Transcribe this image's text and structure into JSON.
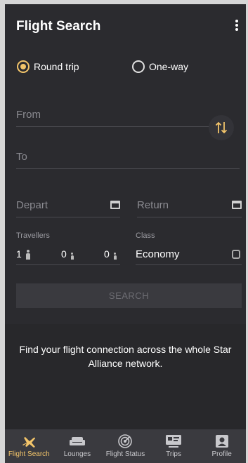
{
  "header": {
    "title": "Flight Search",
    "menu_icon": "more-vertical-icon"
  },
  "trip_type": {
    "options": [
      {
        "label": "Round trip",
        "selected": true
      },
      {
        "label": "One-way",
        "selected": false
      }
    ]
  },
  "form": {
    "from_placeholder": "From",
    "to_placeholder": "To",
    "swap_icon": "swap-vertical-icon",
    "depart_placeholder": "Depart",
    "return_placeholder": "Return",
    "travellers_label": "Travellers",
    "travellers": {
      "adults": "1",
      "children": "0",
      "infants": "0"
    },
    "class_label": "Class",
    "class_value": "Economy"
  },
  "search_button": "SEARCH",
  "info_text": "Find your flight connection across the whole Star Alliance network.",
  "nav": [
    {
      "label": "Flight Search",
      "icon": "plane-icon",
      "active": true
    },
    {
      "label": "Lounges",
      "icon": "sofa-icon",
      "active": false
    },
    {
      "label": "Flight Status",
      "icon": "radar-icon",
      "active": false
    },
    {
      "label": "Trips",
      "icon": "ticket-icon",
      "active": false
    },
    {
      "label": "Profile",
      "icon": "user-icon",
      "active": false
    }
  ],
  "colors": {
    "accent": "#f2c46a",
    "background": "#2b2b2f"
  }
}
